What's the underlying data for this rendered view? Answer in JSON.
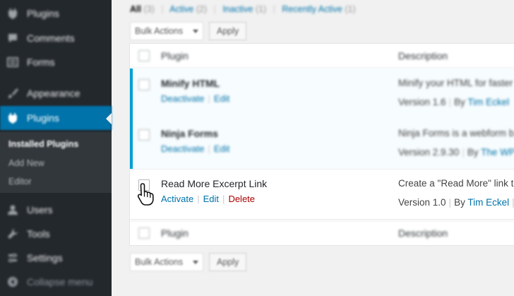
{
  "sidebar": {
    "items": [
      {
        "label": "Plugins",
        "icon": "plugin-icon"
      },
      {
        "label": "Comments",
        "icon": "comment-icon"
      },
      {
        "label": "Forms",
        "icon": "forms-icon"
      },
      {
        "label": "Appearance",
        "icon": "brush-icon"
      },
      {
        "label": "Plugins",
        "icon": "plugin-icon",
        "active": true
      },
      {
        "label": "Users",
        "icon": "users-icon"
      },
      {
        "label": "Tools",
        "icon": "wrench-icon"
      },
      {
        "label": "Settings",
        "icon": "settings-icon"
      },
      {
        "label": "Collapse menu",
        "icon": "collapse-icon"
      }
    ],
    "submenu": [
      {
        "label": "Installed Plugins",
        "current": true
      },
      {
        "label": "Add New"
      },
      {
        "label": "Editor"
      }
    ]
  },
  "filters": {
    "all": "All",
    "all_count": "(3)",
    "active": "Active",
    "active_count": "(2)",
    "inactive": "Inactive",
    "inactive_count": "(1)",
    "recent": "Recently Active",
    "recent_count": "(1)"
  },
  "bulk_top": {
    "select": "Bulk Actions",
    "apply": "Apply"
  },
  "bulk_bottom": {
    "select": "Bulk Actions",
    "apply": "Apply"
  },
  "table": {
    "col_plugin": "Plugin",
    "col_description": "Description",
    "rows": [
      {
        "title": "Minify HTML",
        "actions": [
          "Deactivate",
          "Edit"
        ],
        "description": "Minify your HTML for faster",
        "version": "Version 1.6",
        "by": "By",
        "author": "Tim Eckel"
      },
      {
        "title": "Ninja Forms",
        "actions": [
          "Deactivate",
          "Edit"
        ],
        "description": "Ninja Forms is a webform b",
        "version": "Version 2.9.30",
        "by": "By",
        "author": "The WP"
      },
      {
        "title": "Read More Excerpt Link",
        "actions": [
          "Activate",
          "Edit",
          "Delete"
        ],
        "description": "Create a \"Read More\" link t",
        "version": "Version 1.0",
        "by": "By",
        "author": "Tim Eckel"
      }
    ]
  },
  "colors": {
    "sidebar_bg": "#23282d",
    "active_bg": "#0073aa",
    "link": "#0073aa",
    "delete": "#a00",
    "active_bar": "#00a0d2"
  }
}
